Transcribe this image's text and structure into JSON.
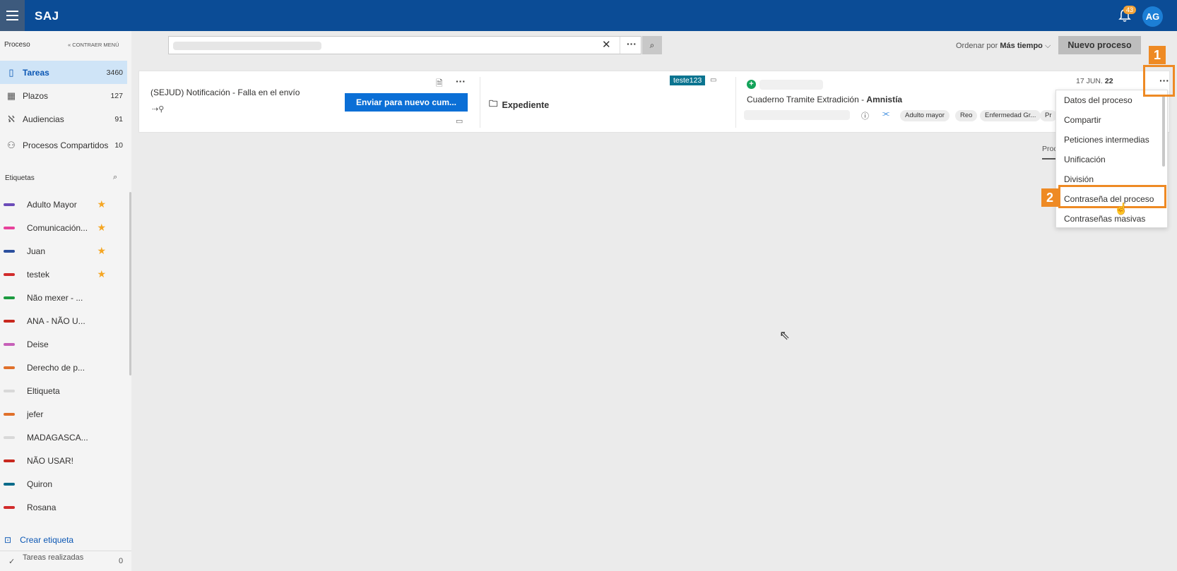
{
  "app": {
    "brand": "SAJ",
    "notification_count": "43",
    "avatar_initials": "AG"
  },
  "sidebar": {
    "section_title": "Proceso",
    "collapse_label": "« CONTRAER MENÚ",
    "items": [
      {
        "label": "Tareas",
        "count": "3460",
        "icon": "bookmark-icon",
        "active": true
      },
      {
        "label": "Plazos",
        "count": "127",
        "icon": "calendar-icon"
      },
      {
        "label": "Audiencias",
        "count": "91",
        "icon": "people-icon"
      },
      {
        "label": "Procesos Compartidos",
        "count": "10",
        "icon": "shared-user-icon"
      }
    ],
    "tags_title": "Etiquetas",
    "tags": [
      {
        "name": "Adulto Mayor",
        "color": "#6b4bb8",
        "starred": true
      },
      {
        "name": "Comunicación...",
        "color": "#e8419b",
        "starred": true
      },
      {
        "name": "Juan",
        "color": "#2b4f9e",
        "starred": true
      },
      {
        "name": "testek",
        "color": "#d12b2b",
        "starred": true
      },
      {
        "name": "Não mexer - ...",
        "color": "#1c9a3f",
        "starred": false
      },
      {
        "name": "ANA - NÃO U...",
        "color": "#c8281e",
        "starred": false
      },
      {
        "name": "Deise",
        "color": "#c65fb8",
        "starred": false
      },
      {
        "name": "Derecho de p...",
        "color": "#e0702a",
        "starred": false
      },
      {
        "name": "Eltiqueta",
        "color": "#d8d8d8",
        "starred": false
      },
      {
        "name": "jefer",
        "color": "#e0702a",
        "starred": false
      },
      {
        "name": "MADAGASCA...",
        "color": "#d8d8d8",
        "starred": false
      },
      {
        "name": "NÃO USAR!",
        "color": "#c8281e",
        "starred": false
      },
      {
        "name": "Quiron",
        "color": "#0b6b8a",
        "starred": false
      },
      {
        "name": "Rosana",
        "color": "#d12b2b",
        "starred": false
      }
    ],
    "create_tag": "Crear etiqueta",
    "done_label": "Tareas realizadas",
    "done_count": "0"
  },
  "toolbar": {
    "sort_prefix": "Ordenar por",
    "sort_value": "Más tiempo",
    "new_process": "Nuevo proceso"
  },
  "card": {
    "title": "(SEJUD) Notificación - Falla en el envío",
    "send_button": "Enviar para nuevo cum...",
    "expediente": "Expediente",
    "badge": "teste123",
    "case_title_prefix": "Cuaderno Tramite Extradición - ",
    "case_title_bold": "Amnistía",
    "chips": [
      "Adulto mayor",
      "Reo",
      "Enfermedad Gr...",
      "Pr"
    ],
    "date_prefix": "17 JUN.",
    "date_bold": "22",
    "proc_cut": "Proc"
  },
  "menu": {
    "items": [
      "Datos del proceso",
      "Compartir",
      "Peticiones intermedias",
      "Unificación",
      "División",
      "Contraseña del proceso",
      "Contraseñas masivas"
    ]
  },
  "annotations": {
    "step1": "1",
    "step2": "2"
  },
  "colors": {
    "topbar": "#0b4c96",
    "accent": "#0b6fd6",
    "annotation": "#ee8a24"
  }
}
